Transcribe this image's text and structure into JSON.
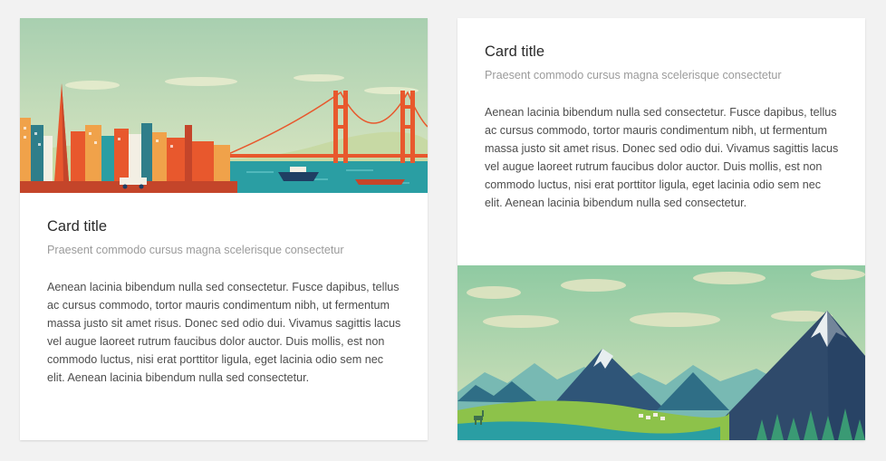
{
  "cards": [
    {
      "title": "Card title",
      "subtitle": "Praesent commodo cursus magna scelerisque consectetur",
      "body": "Aenean lacinia bibendum nulla sed consectetur. Fusce dapibus, tellus ac cursus commodo, tortor mauris condimentum nibh, ut fermentum massa justo sit amet risus. Donec sed odio dui. Vivamus sagittis lacus vel augue laoreet rutrum faucibus dolor auctor. Duis mollis, est non commodo luctus, nisi erat porttitor ligula, eget lacinia odio sem nec elit. Aenean lacinia bibendum nulla sed consectetur.",
      "media_position": "top"
    },
    {
      "title": "Card title",
      "subtitle": "Praesent commodo cursus magna scelerisque consectetur",
      "body": "Aenean lacinia bibendum nulla sed consectetur. Fusce dapibus, tellus ac cursus commodo, tortor mauris condimentum nibh, ut fermentum massa justo sit amet risus. Donec sed odio dui. Vivamus sagittis lacus vel augue laoreet rutrum faucibus dolor auctor. Duis mollis, est non commodo luctus, nisi erat porttitor ligula, eget lacinia odio sem nec elit. Aenean lacinia bibendum nulla sed consectetur.",
      "media_position": "bottom"
    }
  ],
  "colors": {
    "background": "#f2f2f2",
    "card": "#ffffff",
    "title": "#2b2b2b",
    "subtitle": "#9b9b9b",
    "body": "#4d4d4d",
    "bridge": "#e8582d",
    "water": "#2a9ea3",
    "sky": "#a9d2b3",
    "mountain": "#2f4a6b",
    "meadow": "#8dc24a"
  }
}
